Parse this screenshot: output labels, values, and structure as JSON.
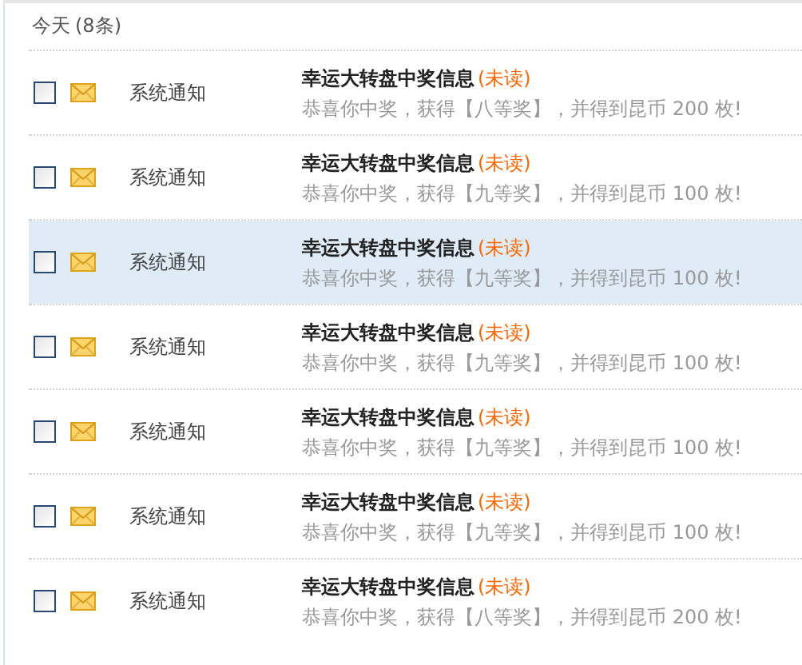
{
  "group": {
    "label": "今天",
    "count": "(8条)"
  },
  "messages": [
    {
      "checked": false,
      "highlighted": false,
      "unread": true,
      "sender": "系统通知",
      "title": "幸运大转盘中奖信息",
      "tag": "(未读)",
      "summary": "恭喜你中奖，获得【八等奖】，并得到昆币 200 枚!"
    },
    {
      "checked": false,
      "highlighted": false,
      "unread": true,
      "sender": "系统通知",
      "title": "幸运大转盘中奖信息",
      "tag": "(未读)",
      "summary": "恭喜你中奖，获得【九等奖】，并得到昆币 100 枚!"
    },
    {
      "checked": false,
      "highlighted": true,
      "unread": true,
      "sender": "系统通知",
      "title": "幸运大转盘中奖信息",
      "tag": "(未读)",
      "summary": "恭喜你中奖，获得【九等奖】，并得到昆币 100 枚!"
    },
    {
      "checked": false,
      "highlighted": false,
      "unread": true,
      "sender": "系统通知",
      "title": "幸运大转盘中奖信息",
      "tag": "(未读)",
      "summary": "恭喜你中奖，获得【九等奖】，并得到昆币 100 枚!"
    },
    {
      "checked": false,
      "highlighted": false,
      "unread": true,
      "sender": "系统通知",
      "title": "幸运大转盘中奖信息",
      "tag": "(未读)",
      "summary": "恭喜你中奖，获得【九等奖】，并得到昆币 100 枚!"
    },
    {
      "checked": false,
      "highlighted": false,
      "unread": true,
      "sender": "系统通知",
      "title": "幸运大转盘中奖信息",
      "tag": "(未读)",
      "summary": "恭喜你中奖，获得【九等奖】，并得到昆币 100 枚!"
    },
    {
      "checked": false,
      "highlighted": false,
      "unread": true,
      "sender": "系统通知",
      "title": "幸运大转盘中奖信息",
      "tag": "(未读)",
      "summary": "恭喜你中奖，获得【八等奖】，并得到昆币 200 枚!"
    }
  ]
}
